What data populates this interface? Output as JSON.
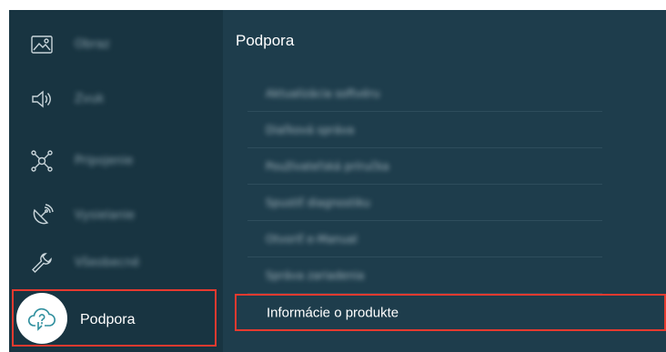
{
  "left_menu": {
    "items": [
      {
        "icon": "picture-icon",
        "label": "Obraz"
      },
      {
        "icon": "sound-icon",
        "label": "Zvuk"
      },
      {
        "icon": "connection-icon",
        "label": "Pripojenie"
      },
      {
        "icon": "broadcast-icon",
        "label": "Vysielanie"
      },
      {
        "icon": "wrench-icon",
        "label": "Všeobecné"
      }
    ],
    "selected": {
      "icon": "support-cloud-icon",
      "label": "Podpora"
    }
  },
  "right_panel": {
    "title": "Podpora",
    "items": [
      {
        "label": "Aktualizácia softvéru"
      },
      {
        "label": "Diaľková správa"
      },
      {
        "label": "Používateľská príručka"
      },
      {
        "label": "Spustiť diagnostiku"
      },
      {
        "label": "Otvoriť e-Manual"
      },
      {
        "label": "Správa zariadenia"
      }
    ],
    "selected_item": "Informácie o produkte"
  },
  "colors": {
    "background": "#1e3d4c",
    "left_panel": "#183441",
    "highlight": "#e63a2f",
    "text": "#ffffff"
  }
}
